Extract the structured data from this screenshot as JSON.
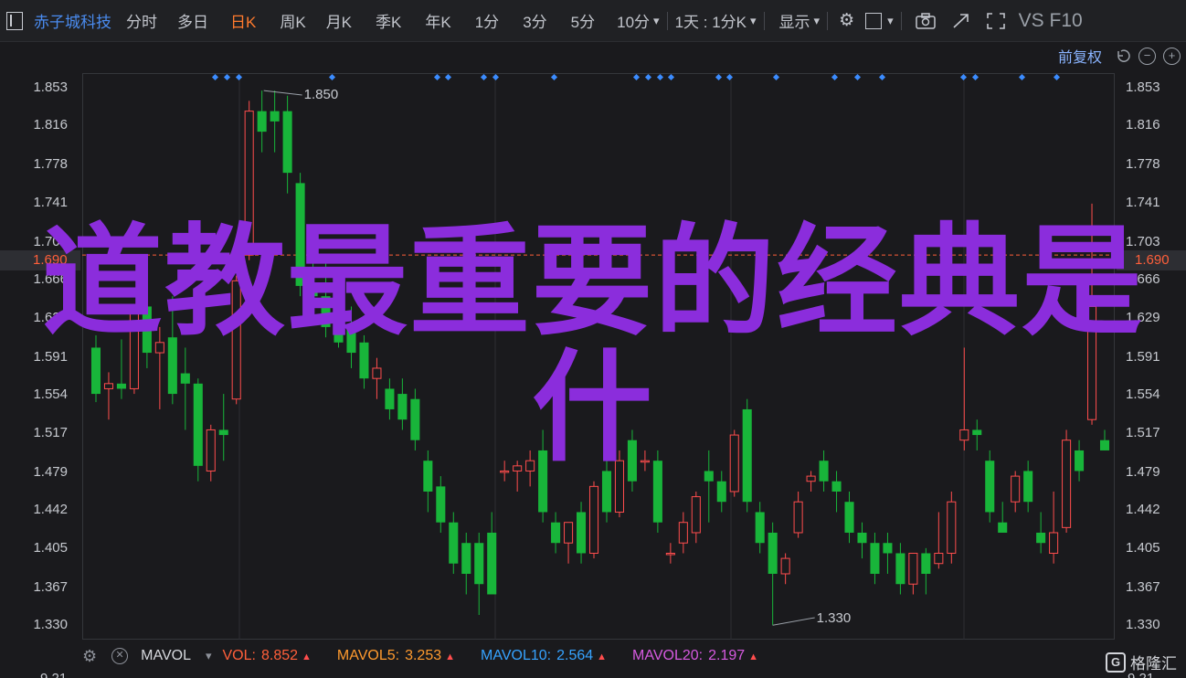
{
  "toolbar": {
    "stock_name": "赤子城科技",
    "periods": [
      "分时",
      "多日",
      "日K",
      "周K",
      "月K",
      "季K",
      "年K",
      "1分",
      "3分",
      "5分",
      "10分"
    ],
    "active_period": "日K",
    "range_select": "1天 : 1分K",
    "display_label": "显示",
    "vs_f10": "VS F10",
    "icons": [
      "chart-type-icon",
      "gear-icon",
      "square-icon",
      "camera-icon",
      "share-icon",
      "fullscreen-icon"
    ]
  },
  "chart_header": {
    "adjust_label": "前复权"
  },
  "axis": {
    "left_ticks": [
      "1.853",
      "1.816",
      "1.778",
      "1.741",
      "1.703",
      "1.666",
      "1.629",
      "1.591",
      "1.554",
      "1.517",
      "1.479",
      "1.442",
      "1.405",
      "1.367",
      "1.330"
    ],
    "right_ticks": [
      "1.853",
      "1.816",
      "1.778",
      "1.741",
      "1.703",
      "1.666",
      "1.629",
      "1.591",
      "1.554",
      "1.517",
      "1.479",
      "1.442",
      "1.405",
      "1.367",
      "1.330"
    ],
    "current_price": "1.690",
    "bottom_cut_label": "9.21"
  },
  "annotations": {
    "high": "1.850",
    "low": "1.330"
  },
  "volume": {
    "indicator": "MAVOL",
    "vol_label": "VOL:",
    "vol_value": "8.852",
    "mavol5_label": "MAVOL5:",
    "mavol5_value": "3.253",
    "mavol10_label": "MAVOL10:",
    "mavol10_value": "2.564",
    "mavol20_label": "MAVOL20:",
    "mavol20_value": "2.197",
    "colors": {
      "vol": "#ff5f3a",
      "mavol5": "#ff9a2e",
      "mavol10": "#36a3ff",
      "mavol20": "#d65ae0"
    }
  },
  "watermark": "格隆汇",
  "overlay_title": "道教最重要的经典是什",
  "colors": {
    "up": "#ff4d4d",
    "down": "#18b53a",
    "bg": "#1a1a1d",
    "grid": "#2a2b30",
    "marker": "#3b8cff",
    "overlay": "#8b2ddc"
  },
  "chart_data": {
    "type": "candlestick",
    "ylim": [
      1.316,
      1.867
    ],
    "candles": [
      [
        1.6,
        1.612,
        1.547,
        1.555
      ],
      [
        1.56,
        1.576,
        1.53,
        1.565
      ],
      [
        1.565,
        1.608,
        1.55,
        1.56
      ],
      [
        1.56,
        1.64,
        1.555,
        1.635
      ],
      [
        1.64,
        1.66,
        1.58,
        1.595
      ],
      [
        1.595,
        1.62,
        1.54,
        1.605
      ],
      [
        1.61,
        1.65,
        1.545,
        1.555
      ],
      [
        1.575,
        1.6,
        1.52,
        1.565
      ],
      [
        1.565,
        1.57,
        1.47,
        1.485
      ],
      [
        1.48,
        1.525,
        1.47,
        1.52
      ],
      [
        1.52,
        1.555,
        1.49,
        1.515
      ],
      [
        1.55,
        1.67,
        1.545,
        1.665
      ],
      [
        1.69,
        1.84,
        1.685,
        1.83
      ],
      [
        1.83,
        1.85,
        1.79,
        1.81
      ],
      [
        1.83,
        1.85,
        1.79,
        1.82
      ],
      [
        1.83,
        1.845,
        1.75,
        1.77
      ],
      [
        1.76,
        1.77,
        1.65,
        1.66
      ],
      [
        1.66,
        1.69,
        1.63,
        1.65
      ],
      [
        1.65,
        1.69,
        1.61,
        1.62
      ],
      [
        1.64,
        1.66,
        1.6,
        1.605
      ],
      [
        1.62,
        1.64,
        1.58,
        1.595
      ],
      [
        1.605,
        1.612,
        1.56,
        1.57
      ],
      [
        1.57,
        1.59,
        1.55,
        1.58
      ],
      [
        1.56,
        1.57,
        1.53,
        1.54
      ],
      [
        1.555,
        1.57,
        1.52,
        1.53
      ],
      [
        1.55,
        1.56,
        1.5,
        1.51
      ],
      [
        1.49,
        1.5,
        1.44,
        1.46
      ],
      [
        1.465,
        1.475,
        1.42,
        1.43
      ],
      [
        1.43,
        1.44,
        1.38,
        1.39
      ],
      [
        1.41,
        1.42,
        1.36,
        1.38
      ],
      [
        1.41,
        1.42,
        1.34,
        1.37
      ],
      [
        1.42,
        1.44,
        1.36,
        1.36
      ],
      [
        1.48,
        1.49,
        1.47,
        1.48
      ],
      [
        1.48,
        1.49,
        1.46,
        1.485
      ],
      [
        1.48,
        1.5,
        1.465,
        1.49
      ],
      [
        1.5,
        1.52,
        1.43,
        1.44
      ],
      [
        1.43,
        1.44,
        1.4,
        1.41
      ],
      [
        1.41,
        1.43,
        1.39,
        1.43
      ],
      [
        1.44,
        1.45,
        1.39,
        1.4
      ],
      [
        1.4,
        1.47,
        1.395,
        1.465
      ],
      [
        1.48,
        1.49,
        1.43,
        1.44
      ],
      [
        1.44,
        1.5,
        1.435,
        1.49
      ],
      [
        1.51,
        1.52,
        1.46,
        1.47
      ],
      [
        1.49,
        1.5,
        1.48,
        1.49
      ],
      [
        1.49,
        1.5,
        1.42,
        1.43
      ],
      [
        1.4,
        1.41,
        1.39,
        1.4
      ],
      [
        1.41,
        1.44,
        1.4,
        1.43
      ],
      [
        1.42,
        1.46,
        1.41,
        1.455
      ],
      [
        1.48,
        1.5,
        1.43,
        1.47
      ],
      [
        1.47,
        1.48,
        1.44,
        1.45
      ],
      [
        1.46,
        1.52,
        1.455,
        1.515
      ],
      [
        1.54,
        1.55,
        1.44,
        1.45
      ],
      [
        1.44,
        1.45,
        1.4,
        1.41
      ],
      [
        1.42,
        1.43,
        1.33,
        1.38
      ],
      [
        1.38,
        1.4,
        1.37,
        1.395
      ],
      [
        1.42,
        1.46,
        1.415,
        1.45
      ],
      [
        1.47,
        1.48,
        1.46,
        1.475
      ],
      [
        1.49,
        1.5,
        1.46,
        1.47
      ],
      [
        1.47,
        1.48,
        1.44,
        1.46
      ],
      [
        1.45,
        1.46,
        1.41,
        1.42
      ],
      [
        1.42,
        1.43,
        1.395,
        1.41
      ],
      [
        1.41,
        1.42,
        1.37,
        1.38
      ],
      [
        1.41,
        1.42,
        1.38,
        1.4
      ],
      [
        1.4,
        1.41,
        1.36,
        1.37
      ],
      [
        1.37,
        1.4,
        1.36,
        1.4
      ],
      [
        1.4,
        1.405,
        1.36,
        1.38
      ],
      [
        1.39,
        1.44,
        1.385,
        1.4
      ],
      [
        1.4,
        1.46,
        1.39,
        1.45
      ],
      [
        1.51,
        1.6,
        1.5,
        1.52
      ],
      [
        1.52,
        1.53,
        1.5,
        1.515
      ],
      [
        1.49,
        1.5,
        1.43,
        1.44
      ],
      [
        1.43,
        1.45,
        1.42,
        1.42
      ],
      [
        1.45,
        1.48,
        1.44,
        1.475
      ],
      [
        1.48,
        1.49,
        1.44,
        1.45
      ],
      [
        1.42,
        1.44,
        1.4,
        1.41
      ],
      [
        1.4,
        1.46,
        1.39,
        1.42
      ],
      [
        1.425,
        1.52,
        1.42,
        1.51
      ],
      [
        1.5,
        1.51,
        1.47,
        1.48
      ],
      [
        1.53,
        1.74,
        1.525,
        1.64
      ],
      [
        1.51,
        1.52,
        1.5,
        1.5
      ]
    ]
  }
}
